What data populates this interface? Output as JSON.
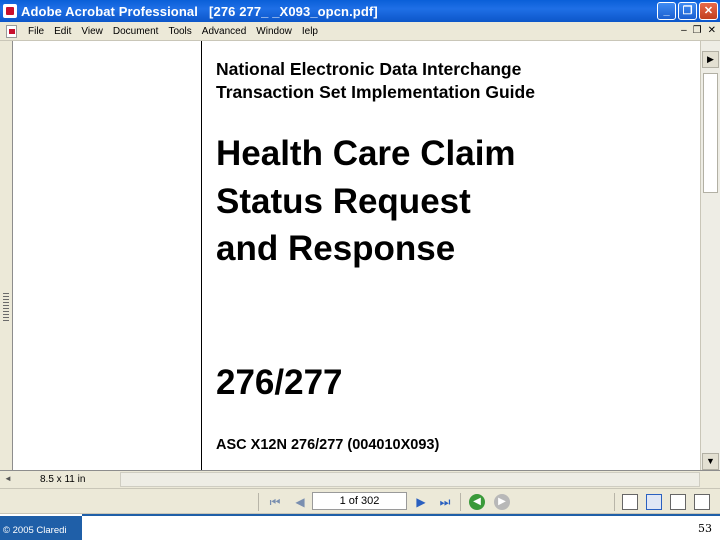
{
  "window": {
    "title": "Adobe Acrobat Professional   [276 277_ _X093_opcn.pdf]",
    "min_glyph": "_",
    "max_glyph": "❐",
    "close_glyph": "✕"
  },
  "menu": {
    "items": [
      "File",
      "Edit",
      "View",
      "Document",
      "Tools",
      "Advanced",
      "Window",
      "Ielp"
    ],
    "mdi": {
      "min_glyph": "–",
      "restore_glyph": "❐",
      "close_glyph": "✕"
    }
  },
  "document": {
    "subtitle_line1": "National Electronic Data Interchange",
    "subtitle_line2": "Transaction Set Implementation Guide",
    "title_line1": "Health Care Claim",
    "title_line2": "Status Request",
    "title_line3": "and Response",
    "code": "276/277",
    "asc_line": "ASC X12N 276/277 (004010X093)"
  },
  "status": {
    "page_size": "8.5 x 11 in",
    "left_arrow_glyph": "◄"
  },
  "navigation": {
    "page_display": "1 of 302",
    "first_glyph": "⏮",
    "prev_glyph": "◀",
    "next_glyph": "▶",
    "last_glyph": "⏭",
    "back_glyph": "◀",
    "forward_glyph": "▶"
  },
  "scrollbar": {
    "up_glyph": "▶",
    "down_glyph": "▼"
  },
  "footer": {
    "copyright": "© 2005 Claredi",
    "slide_number": "53"
  }
}
